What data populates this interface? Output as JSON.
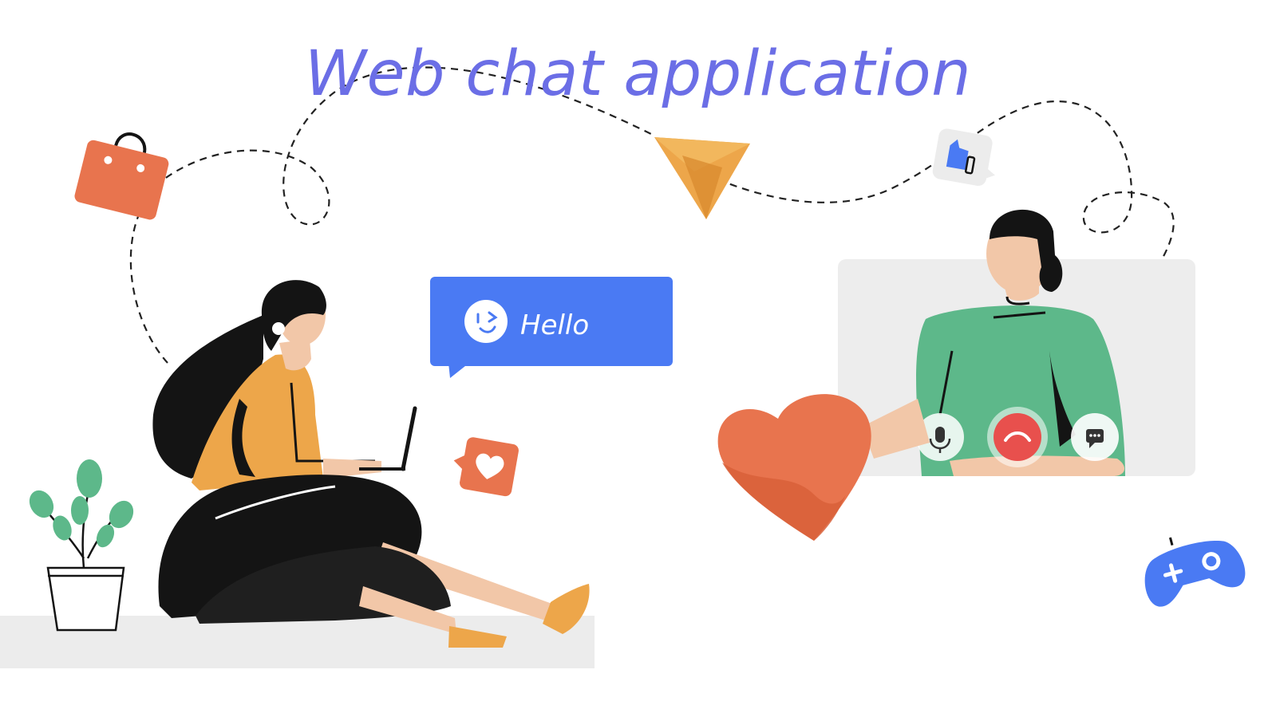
{
  "title": "Web chat application",
  "chat_bubble": {
    "text": "Hello"
  },
  "colors": {
    "title": "#6b6ee6",
    "blue": "#4a7af3",
    "orange": "#e8744e",
    "amber": "#eda64a",
    "green": "#5db88a",
    "skin": "#f2c7a8",
    "black": "#141414",
    "gray_panel": "#ededed",
    "end_call_red": "#e8504d"
  },
  "icons": [
    "shopping-bag-icon",
    "paper-plane-icon",
    "thumbs-up-icon",
    "heart-icon",
    "gamepad-icon",
    "microphone-icon",
    "end-call-icon",
    "chat-icon",
    "smiley-icon",
    "plant-icon",
    "laptop-icon"
  ]
}
